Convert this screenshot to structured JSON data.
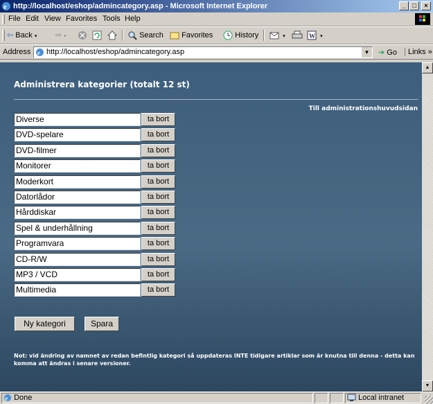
{
  "window": {
    "title": "http://localhost/eshop/admincategory.asp - Microsoft Internet Explorer",
    "minimize": "_",
    "maximize": "□",
    "close": "×"
  },
  "menu": {
    "items": [
      "File",
      "Edit",
      "View",
      "Favorites",
      "Tools",
      "Help"
    ],
    "accelerators": [
      "F",
      "E",
      "V",
      "a",
      "T",
      "H"
    ]
  },
  "toolbar": {
    "back": "Back",
    "search": "Search",
    "favorites": "Favorites",
    "history": "History"
  },
  "address": {
    "label": "Address",
    "url": "http://localhost/eshop/admincategory.asp",
    "go": "Go",
    "links": "Links »"
  },
  "page": {
    "heading": "Administrera kategorier (totalt 12 st)",
    "admin_link": "Till administrationshuvudsidan",
    "delete_label": "ta bort",
    "categories": [
      "Diverse",
      "DVD-spelare",
      "DVD-filmer",
      "Monitorer",
      "Moderkort",
      "Datorlådor",
      "Hårddiskar",
      "Spel  & underhållning",
      "Programvara",
      "CD-R/W",
      "MP3 / VCD",
      "Multimedia"
    ],
    "new_category_button": "Ny kategori",
    "save_button": "Spara",
    "note": "Not: vid ändring av namnet av redan befintlig kategori så uppdateras INTE tidigare artiklar som är knutna till denna - detta kan komma att ändras i senare versioner."
  },
  "status": {
    "text": "Done",
    "zone": "Local intranet"
  }
}
